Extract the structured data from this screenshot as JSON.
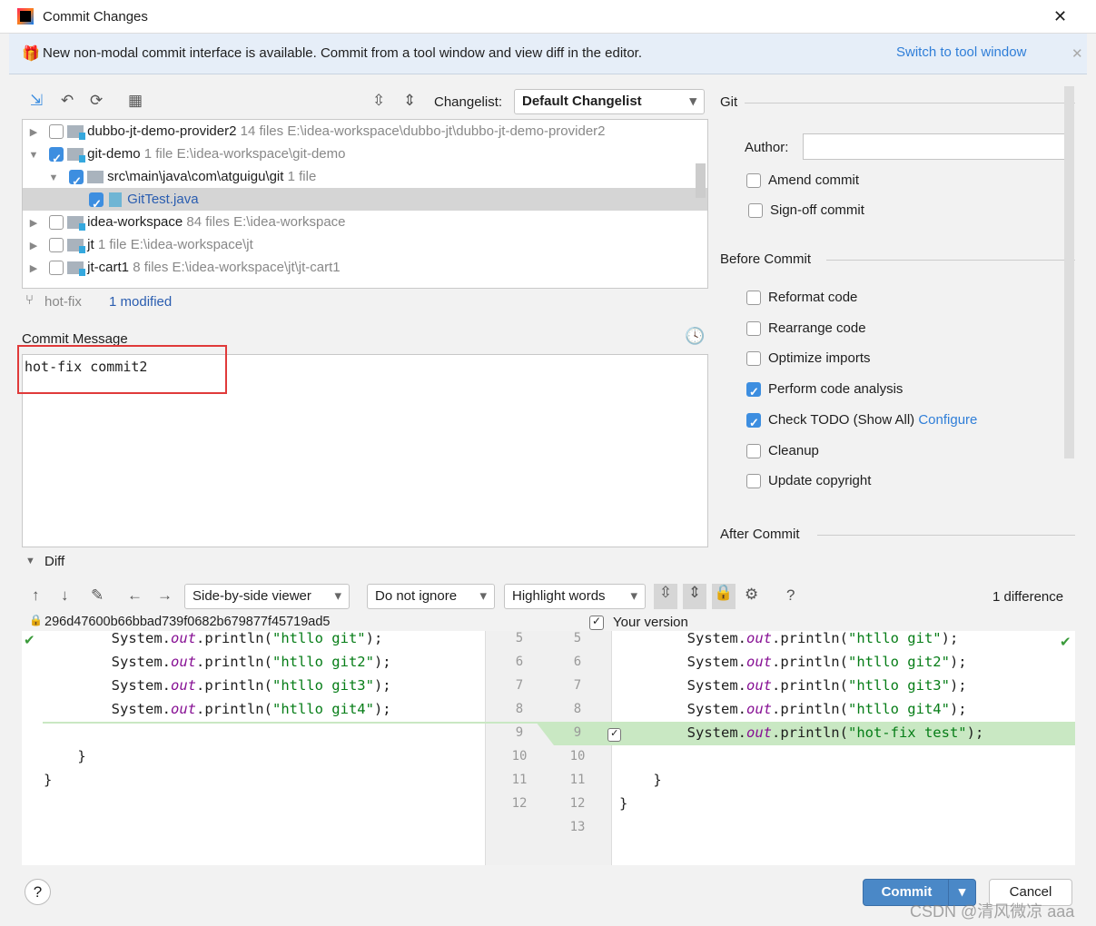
{
  "window": {
    "title": "Commit Changes",
    "close": "✕"
  },
  "banner": {
    "text": "New non-modal commit interface is available. Commit from a tool window and view diff in the editor.",
    "link": "Switch to tool window",
    "close": "✕"
  },
  "changelist": {
    "label": "Changelist:",
    "value": "Default Changelist"
  },
  "tree": [
    {
      "name": "dubbo-jt-demo-provider2",
      "count": "14 files",
      "path": "E:\\idea-workspace\\dubbo-jt\\dubbo-jt-demo-provider2",
      "checked": false,
      "expanded": false,
      "level": 0
    },
    {
      "name": "git-demo",
      "count": "1 file",
      "path": "E:\\idea-workspace\\git-demo",
      "checked": true,
      "expanded": true,
      "level": 0
    },
    {
      "name": "src\\main\\java\\com\\atguigu\\git",
      "count": "1 file",
      "path": "",
      "checked": true,
      "expanded": true,
      "level": 1
    },
    {
      "name": "GitTest.java",
      "count": "",
      "path": "",
      "checked": true,
      "level": 2,
      "file": true,
      "selected": true
    },
    {
      "name": "idea-workspace",
      "count": "84 files",
      "path": "E:\\idea-workspace",
      "checked": false,
      "expanded": false,
      "level": 0
    },
    {
      "name": "jt",
      "count": "1 file",
      "path": "E:\\idea-workspace\\jt",
      "checked": false,
      "expanded": false,
      "level": 0
    },
    {
      "name": "jt-cart1",
      "count": "8 files",
      "path": "E:\\idea-workspace\\jt\\jt-cart1",
      "checked": false,
      "expanded": false,
      "level": 0
    }
  ],
  "status": {
    "branch": "hot-fix",
    "modified": "1 modified"
  },
  "commit_message": {
    "label": "Commit Message",
    "value": "hot-fix commit2"
  },
  "git": {
    "header": "Git",
    "author_label": "Author:",
    "author_value": "",
    "amend": "Amend commit",
    "signoff": "Sign-off commit"
  },
  "before_commit": {
    "header": "Before Commit",
    "options": [
      {
        "label": "Reformat code",
        "checked": false
      },
      {
        "label": "Rearrange code",
        "checked": false
      },
      {
        "label": "Optimize imports",
        "checked": false
      },
      {
        "label": "Perform code analysis",
        "checked": true
      },
      {
        "label": "Check TODO (Show All)",
        "checked": true,
        "link": "Configure"
      },
      {
        "label": "Cleanup",
        "checked": false
      },
      {
        "label": "Update copyright",
        "checked": false
      }
    ]
  },
  "after_commit": {
    "header": "After Commit"
  },
  "diff": {
    "header": "Diff",
    "viewer": "Side-by-side viewer",
    "ignore": "Do not ignore",
    "highlight": "Highlight words",
    "help": "?",
    "count": "1 difference",
    "left_title": "296d47600b66bbad739f0682b679877f45719ad5",
    "right_title": "Your version",
    "left_lines": [
      "        System.out.println(\"htllo git\");",
      "        System.out.println(\"htllo git2\");",
      "        System.out.println(\"htllo git3\");",
      "        System.out.println(\"htllo git4\");",
      "",
      "    }",
      "}",
      ""
    ],
    "left_numbers": [
      "5",
      "6",
      "7",
      "8",
      "9",
      "10",
      "11",
      "12"
    ],
    "right_lines": [
      "        System.out.println(\"htllo git\");",
      "        System.out.println(\"htllo git2\");",
      "        System.out.println(\"htllo git3\");",
      "        System.out.println(\"htllo git4\");",
      "        System.out.println(\"hot-fix test\");",
      "",
      "    }",
      "}",
      ""
    ],
    "right_numbers": [
      "5",
      "6",
      "7",
      "8",
      "9",
      "10",
      "11",
      "12",
      "13"
    ],
    "added_color": "#c9e8c3"
  },
  "footer": {
    "help": "?",
    "commit": "Commit",
    "cancel": "Cancel"
  },
  "watermark": "CSDN @清风微凉 aaa"
}
